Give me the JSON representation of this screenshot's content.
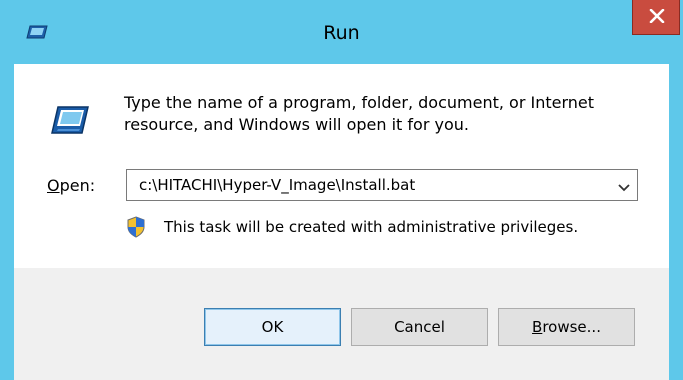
{
  "window": {
    "title": "Run"
  },
  "icons": {
    "title_icon": "run-program-icon",
    "close": "close-icon",
    "program": "run-program-icon",
    "dropdown": "chevron-down-icon",
    "shield": "uac-shield-icon"
  },
  "dialog": {
    "description": "Type the name of a program, folder, document, or Internet resource, and Windows will open it for you.",
    "open_label_prefix": "",
    "open_label_accel": "O",
    "open_label_rest": "pen:",
    "open_value": "c:\\HITACHI\\Hyper-V_Image\\Install.bat",
    "admin_note": "This task will be created with administrative privileges."
  },
  "buttons": {
    "ok": "OK",
    "cancel": "Cancel",
    "browse_accel": "B",
    "browse_rest": "rowse..."
  },
  "colors": {
    "frame": "#5ec8ea",
    "close_button": "#c94c3f",
    "footer": "#f0f0f0"
  }
}
